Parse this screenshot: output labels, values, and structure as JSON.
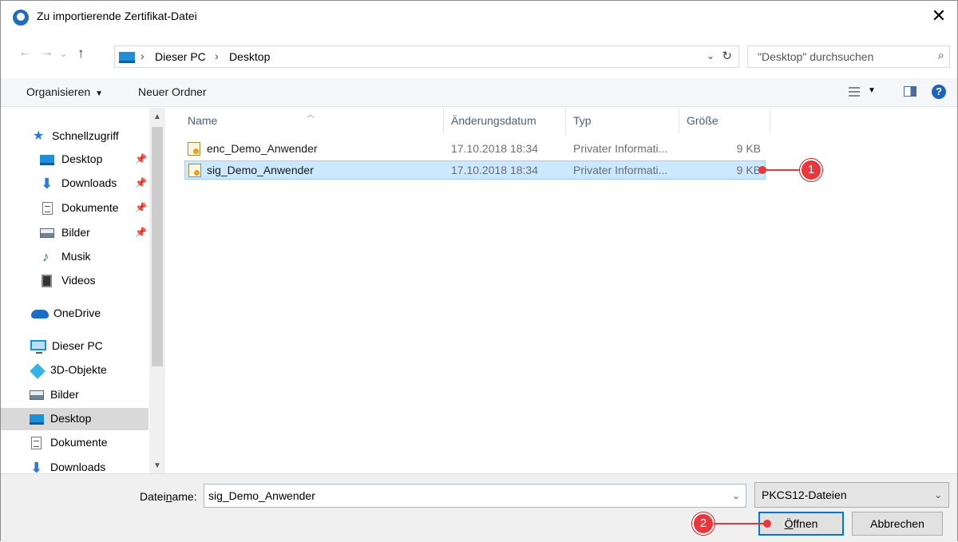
{
  "window": {
    "title": "Zu importierende Zertifikat-Datei",
    "close_glyph": "✕"
  },
  "address": {
    "crumbs": [
      "Dieser PC",
      "Desktop"
    ],
    "separator": "›",
    "search_placeholder": "\"Desktop\" durchsuchen"
  },
  "toolbar": {
    "organize_label": "Organisieren",
    "new_folder_label": "Neuer Ordner",
    "help_label": "?"
  },
  "sidebar": {
    "items": [
      {
        "label": "Schnellzugriff",
        "icon": "star-icon"
      },
      {
        "label": "Desktop",
        "icon": "desktop-icon",
        "pinned": true
      },
      {
        "label": "Downloads",
        "icon": "download-icon",
        "pinned": true
      },
      {
        "label": "Dokumente",
        "icon": "document-icon",
        "pinned": true
      },
      {
        "label": "Bilder",
        "icon": "pictures-icon",
        "pinned": true
      },
      {
        "label": "Musik",
        "icon": "music-icon"
      },
      {
        "label": "Videos",
        "icon": "video-icon"
      },
      {
        "label": "OneDrive",
        "icon": "cloud-icon"
      },
      {
        "label": "Dieser PC",
        "icon": "computer-icon"
      },
      {
        "label": "3D-Objekte",
        "icon": "cube-icon"
      },
      {
        "label": "Bilder",
        "icon": "pictures-icon"
      },
      {
        "label": "Desktop",
        "icon": "desktop-icon",
        "selected": true
      },
      {
        "label": "Dokumente",
        "icon": "document-icon"
      },
      {
        "label": "Downloads",
        "icon": "download-icon"
      }
    ]
  },
  "filelist": {
    "columns": [
      "Name",
      "Änderungsdatum",
      "Typ",
      "Größe"
    ],
    "rows": [
      {
        "name": "enc_Demo_Anwender",
        "date": "17.10.2018 18:34",
        "type": "Privater Informati...",
        "size": "9 KB",
        "selected": false
      },
      {
        "name": "sig_Demo_Anwender",
        "date": "17.10.2018 18:34",
        "type": "Privater Informati...",
        "size": "9 KB",
        "selected": true
      }
    ]
  },
  "footer": {
    "filename_label_pre": "Datei",
    "filename_label_u": "n",
    "filename_label_post": "ame:",
    "filename_value": "sig_Demo_Anwender",
    "filter_value": "PKCS12-Dateien",
    "open_label_u": "Ö",
    "open_label_rest": "ffnen",
    "cancel_label": "Abbrechen"
  },
  "annotations": {
    "badge1": "1",
    "badge2": "2",
    "accent": "#e8373d"
  }
}
